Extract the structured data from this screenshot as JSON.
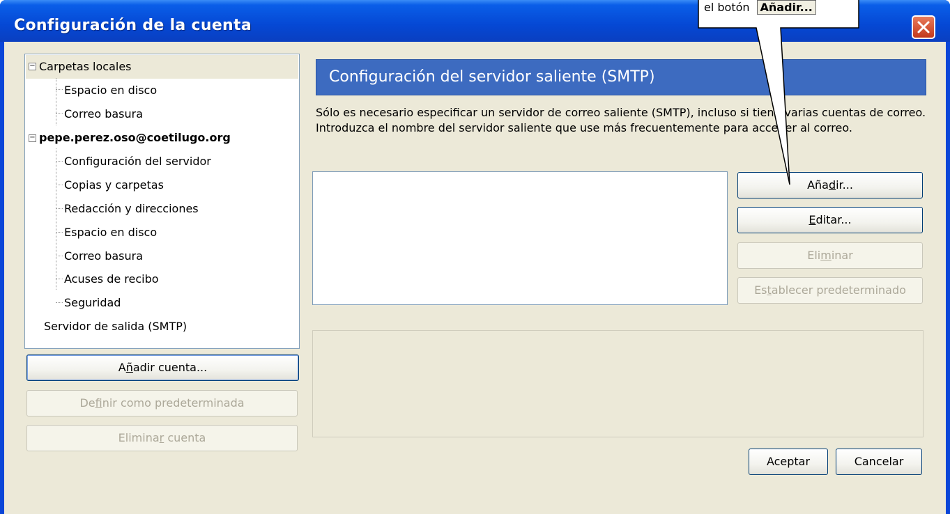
{
  "window": {
    "title": "Configuración de la cuenta"
  },
  "tree": {
    "items": [
      {
        "label": "Carpetas locales",
        "expander": "−"
      },
      {
        "label": "Espacio en disco"
      },
      {
        "label": "Correo basura"
      },
      {
        "label": "pepe.perez.oso@coetilugo.org",
        "expander": "−"
      },
      {
        "label": "Configuración del servidor"
      },
      {
        "label": "Copias y carpetas"
      },
      {
        "label": "Redacción y direcciones"
      },
      {
        "label": "Espacio en disco"
      },
      {
        "label": "Correo basura"
      },
      {
        "label": "Acuses de recibo"
      },
      {
        "label": "Seguridad"
      },
      {
        "label": "Servidor de salida (SMTP)"
      }
    ]
  },
  "left_buttons": {
    "add_account_pre": "A",
    "add_account_u": "ñ",
    "add_account_post": "adir cuenta...",
    "set_default_pre": "De",
    "set_default_u": "f",
    "set_default_post": "inir como predeterminada",
    "remove_account_pre": "Elimina",
    "remove_account_u": "r",
    "remove_account_post": " cuenta"
  },
  "panel": {
    "header": "Configuración del servidor saliente (SMTP)",
    "description": "Sólo es necesario especificar un servidor de correo saliente (SMTP), incluso si tiene varias cuentas de correo. Introduzca el nombre del servidor saliente que use más frecuentemente para acceder al correo."
  },
  "smtp_buttons": {
    "add_pre": "Aña",
    "add_u": "d",
    "add_post": "ir...",
    "edit_pre": "",
    "edit_u": "E",
    "edit_post": "ditar...",
    "delete_pre": "Eli",
    "delete_u": "m",
    "delete_post": "inar",
    "set_default_pre": "Es",
    "set_default_u": "t",
    "set_default_post": "ablecer predeterminado"
  },
  "dialog_buttons": {
    "ok": "Aceptar",
    "cancel": "Cancelar"
  },
  "callout": {
    "text": "el botón",
    "button_label": "Añadir..."
  },
  "colors": {
    "titlebar": "#0548d4",
    "header_bar": "#3d6bc0",
    "client_bg": "#ece9d8",
    "close_button": "#c2381c"
  }
}
